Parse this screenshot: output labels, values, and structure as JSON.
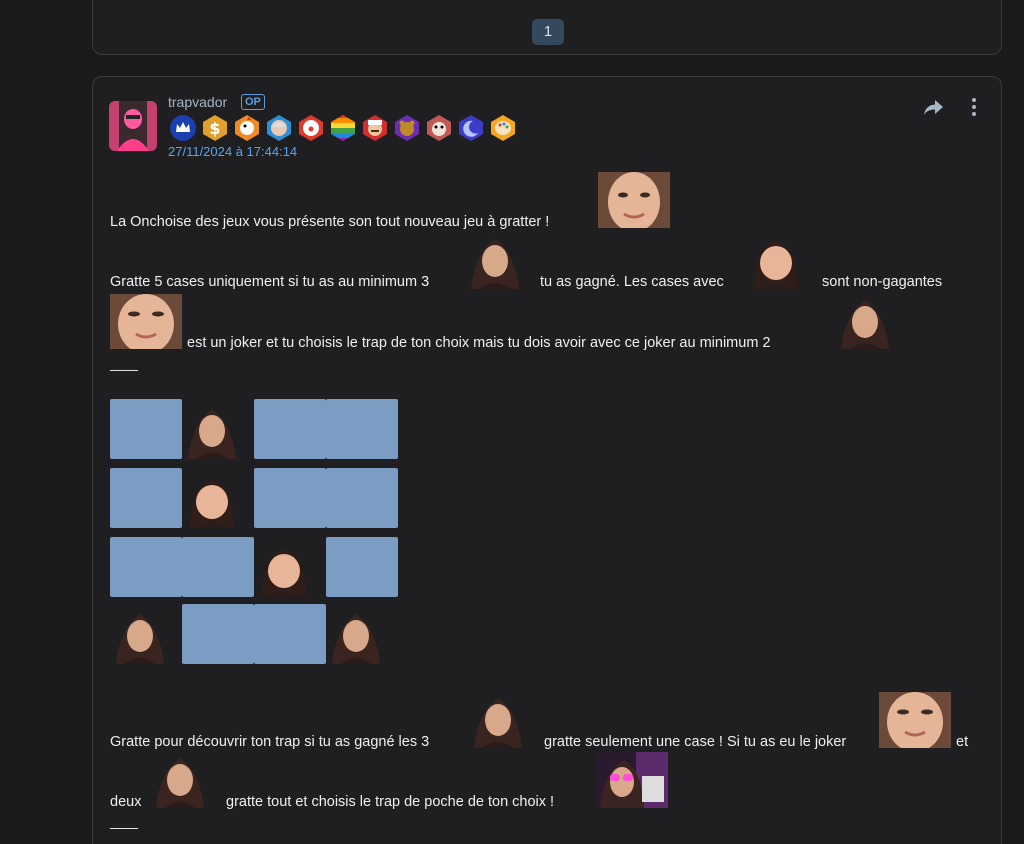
{
  "pager": {
    "current_page": "1"
  },
  "post": {
    "author": "trapvador",
    "op_label": "OP",
    "timestamp": "27/11/2024 à 17:44:14",
    "badges": [
      "crown-badge",
      "dollar-badge",
      "chicken-badge",
      "old-man-badge",
      "clown-badge",
      "rainbow-badge",
      "mario-badge",
      "bear-badge",
      "dog-badge",
      "moon-badge",
      "palette-badge"
    ],
    "actions": {
      "share_icon": "share-icon",
      "more_icon": "more-vertical-icon"
    },
    "body": {
      "line1": "La Onchoise des jeux vous présente son tout nouveau jeu à gratter !",
      "line2a": "Gratte 5 cases uniquement si tu as au minimum 3",
      "line2b": "tu as gagné. Les cases avec",
      "line2c": "sont non-gagantes",
      "line3": "est un joker et tu choisis le trap de ton choix mais tu dois avoir avec ce joker au minimum 2",
      "line4a": "Gratte pour découvrir ton trap si tu as gagné les 3",
      "line4b": "gratte seulement une case ! Si tu as eu le joker",
      "line4c": "et",
      "line5a": "deux",
      "line5b": "gratte tout et choisis le trap de poche de ton choix !"
    }
  },
  "colors": {
    "tile": "#7b9cc3",
    "accent": "#5aa4e8",
    "background": "#1a1a1b"
  }
}
